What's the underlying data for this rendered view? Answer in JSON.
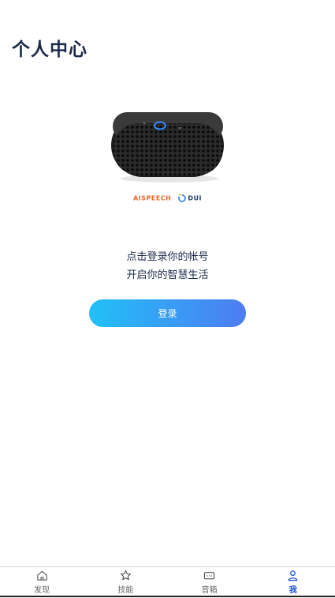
{
  "header": {
    "title": "个人中心"
  },
  "brand": {
    "part1": "AISPE",
    "part2": "ECH",
    "dui": "DUI"
  },
  "prompt": {
    "line1": "点击登录你的帐号",
    "line2": "开启你的智慧生活"
  },
  "login": {
    "label": "登录"
  },
  "colors": {
    "accent": "#1a4fd6",
    "button_start": "#22c0f7",
    "button_end": "#4d7cf2"
  },
  "tabs": [
    {
      "label": "发现",
      "icon": "home-icon",
      "active": false
    },
    {
      "label": "技能",
      "icon": "star-icon",
      "active": false
    },
    {
      "label": "音箱",
      "icon": "speaker-icon",
      "active": false
    },
    {
      "label": "我",
      "icon": "person-icon",
      "active": true
    }
  ]
}
